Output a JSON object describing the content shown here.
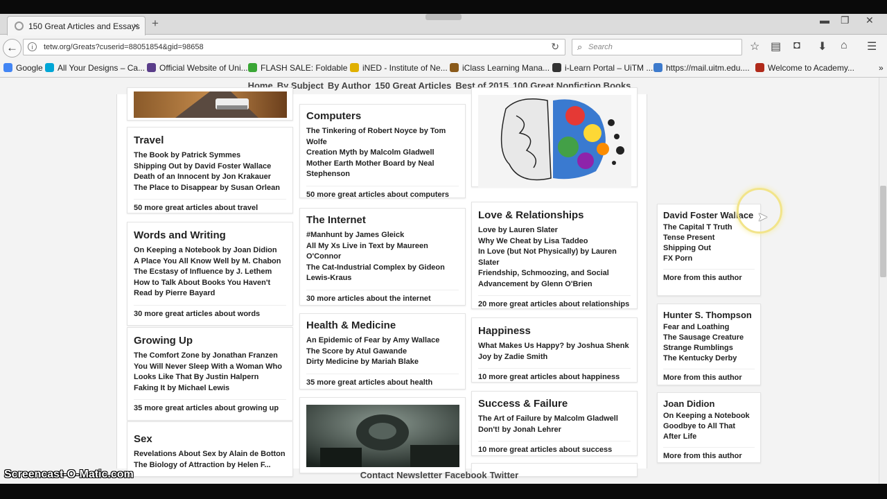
{
  "browser": {
    "tab_title": "150 Great Articles and Essays",
    "tab_close": "×",
    "new_tab": "+",
    "url": "tetw.org/Greats?cuserid=88051854&gid=98658",
    "search_placeholder": "Search",
    "window_min": "▬",
    "window_max": "❐",
    "window_close": "✕"
  },
  "bookmarks": [
    {
      "label": "Google",
      "color": "#4285f4"
    },
    {
      "label": "All Your Designs – Ca...",
      "color": "#00a6d6"
    },
    {
      "label": "Official Website of Uni...",
      "color": "#5a3d8a"
    },
    {
      "label": "FLASH SALE: Foldable ...",
      "color": "#3aa635"
    },
    {
      "label": "iNED - Institute of Ne...",
      "color": "#e0b000"
    },
    {
      "label": "iClass Learning Mana...",
      "color": "#8a5a1a"
    },
    {
      "label": "i-Learn Portal – UiTM ...",
      "color": "#333333"
    },
    {
      "label": "https://mail.uitm.edu....",
      "color": "#3d7acc"
    },
    {
      "label": "Welcome to Academy...",
      "color": "#b02a1a"
    }
  ],
  "sitenav": [
    "Home",
    "By Subject",
    "By Author",
    "150 Great Articles",
    "Best of 2015",
    "100 Great Nonfiction Books"
  ],
  "col1": {
    "travel": {
      "title": "Travel",
      "links": [
        "The Book by Patrick Symmes",
        "Shipping Out by David Foster Wallace",
        "Death of an Innocent by Jon Krakauer",
        "The Place to Disappear by Susan Orlean"
      ],
      "more": "50 more great articles about travel"
    },
    "words": {
      "title": "Words and Writing",
      "links": [
        "On Keeping a Notebook by Joan Didion",
        "A Place You All Know Well by M. Chabon",
        "The Ecstasy of Influence by J. Lethem",
        "How to Talk About Books You Haven't",
        "Read by Pierre Bayard"
      ],
      "more": "30 more great articles about words"
    },
    "growing": {
      "title": "Growing Up",
      "links": [
        "The Comfort Zone by Jonathan Franzen",
        "You Will Never Sleep With a Woman Who",
        "Looks Like That By Justin Halpern",
        "Faking It by Michael Lewis"
      ],
      "more": "35 more great articles about growing up"
    },
    "sex": {
      "title": "Sex",
      "links": [
        "Revelations About Sex by Alain de Botton",
        "The Biology of Attraction by Helen F..."
      ]
    }
  },
  "col2": {
    "computers": {
      "title": "Computers",
      "links": [
        "The Tinkering of Robert Noyce by Tom",
        "Wolfe",
        "Creation Myth by Malcolm Gladwell",
        "Mother Earth Mother Board by Neal",
        "Stephenson"
      ],
      "more": "50 more great articles about computers"
    },
    "internet": {
      "title": "The Internet",
      "links": [
        "#Manhunt by James Gleick",
        "All My Xs Live in Text by Maureen",
        "O'Connor",
        "The Cat-Industrial Complex by Gideon",
        "Lewis-Kraus"
      ],
      "more": "30 more articles about the internet"
    },
    "health": {
      "title": "Health & Medicine",
      "links": [
        "An Epidemic of Fear by Amy Wallace",
        "The Score by Atul Gawande",
        "Dirty Medicine by Mariah Blake"
      ],
      "more": "35 more great articles about health"
    }
  },
  "col3": {
    "love": {
      "title": "Love & Relationships",
      "links": [
        "Love by Lauren Slater",
        "Why We Cheat by Lisa Taddeo",
        "In Love (but Not Physically) by Lauren",
        "Slater",
        "Friendship, Schmoozing, and Social",
        "Advancement by Glenn O'Brien"
      ],
      "more": "20 more great articles about relationships"
    },
    "happiness": {
      "title": "Happiness",
      "links": [
        "What Makes Us Happy? by Joshua Shenk",
        "Joy by Zadie Smith"
      ],
      "more": "10 more great articles about happiness"
    },
    "success": {
      "title": "Success & Failure",
      "links": [
        "The Art of Failure by Malcolm Gladwell",
        "Don't! by Jonah Lehrer"
      ],
      "more": "10 more great articles about success"
    }
  },
  "authors": [
    {
      "name": "David Foster Wallace",
      "works": [
        "The Capital T Truth",
        "Tense Present",
        "Shipping Out",
        "FX Porn"
      ],
      "more": "More from this author"
    },
    {
      "name": "Hunter S. Thompson",
      "works": [
        "Fear and Loathing",
        "The Sausage Creature",
        "Strange Rumblings",
        "The Kentucky Derby"
      ],
      "more": "More from this author"
    },
    {
      "name": "Joan Didion",
      "works": [
        "On Keeping a Notebook",
        "Goodbye to All That",
        "After Life"
      ],
      "more": "More from this author"
    }
  ],
  "footer": [
    "Contact",
    "Newsletter",
    "Facebook",
    "Twitter"
  ],
  "watermark": "Screencast-O-Matic.com"
}
